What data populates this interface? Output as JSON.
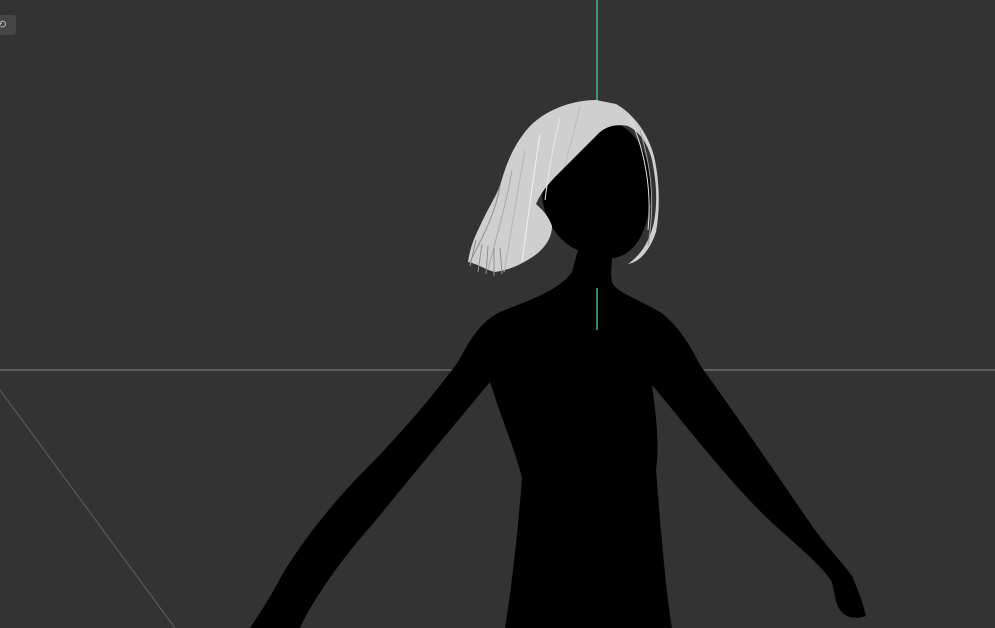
{
  "viewport": {
    "background": "#333333",
    "grid_line_color": "#5a5a5a",
    "vertical_axis_color": "#3fb27a",
    "silhouette_color": "#000000",
    "hair_color": "#d2d2d2"
  },
  "corner_badge": {
    "icon": "view-toggle-icon",
    "glyph": "⟲"
  }
}
